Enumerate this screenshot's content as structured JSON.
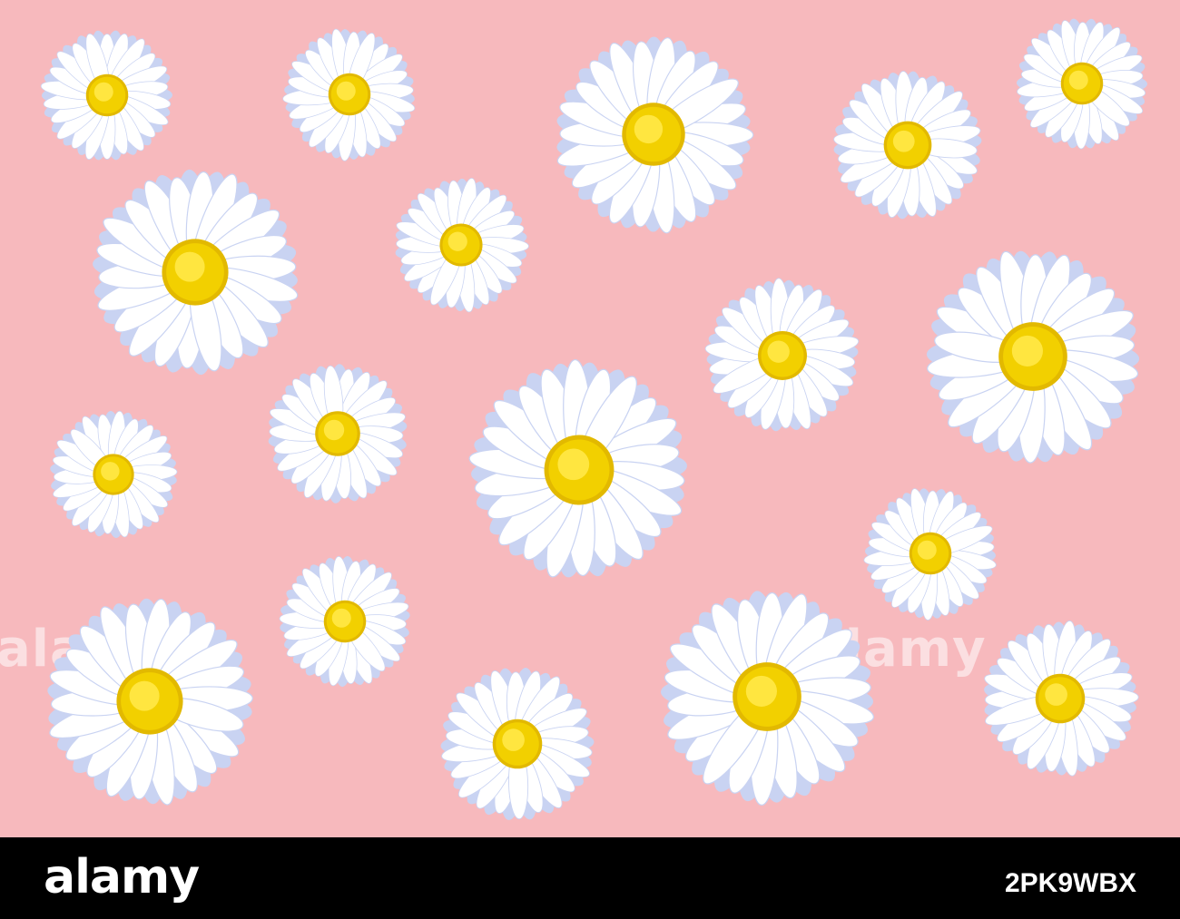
{
  "image": {
    "background_color": "#f7b9bd",
    "petal_color": "#ffffff",
    "petal_shade_color": "#c9d3f2",
    "center_color": "#f2d000",
    "subject": "white-daisy"
  },
  "watermark": {
    "text_left": "alamy",
    "text_mid": "alamy"
  },
  "footer": {
    "logo": "alamy",
    "image_code": "2PK9WBX"
  }
}
